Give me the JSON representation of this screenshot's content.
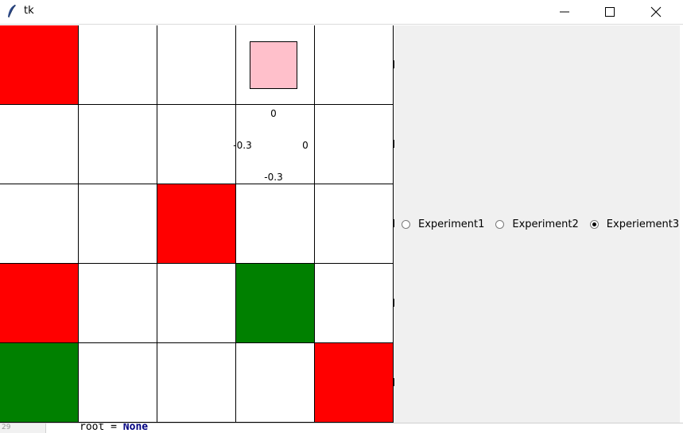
{
  "window": {
    "title": "tk",
    "icon": "tk-feather-icon",
    "controls": [
      "minimize-icon",
      "maximize-icon",
      "close-icon"
    ]
  },
  "grid": {
    "rows": 5,
    "cols": 5,
    "colors": {
      "red": "#ff0000",
      "green": "#008000",
      "white": "#ffffff",
      "agent": "#ffc0cb"
    },
    "cells": [
      [
        "red",
        "white",
        "white",
        "white",
        "white"
      ],
      [
        "white",
        "white",
        "white",
        "white",
        "white"
      ],
      [
        "white",
        "white",
        "red",
        "white",
        "white"
      ],
      [
        "red",
        "white",
        "white",
        "green",
        "white"
      ],
      [
        "green",
        "white",
        "white",
        "white",
        "red"
      ]
    ],
    "agent_cell": [
      0,
      3
    ],
    "q_values": {
      "up": "0",
      "left": "-0.3",
      "right": "0",
      "down": "-0.3"
    }
  },
  "radios": [
    {
      "label": "Experiment1",
      "checked": false
    },
    {
      "label": "Experiment2",
      "checked": false
    },
    {
      "label": "Experiement3",
      "checked": true
    }
  ],
  "editor": {
    "line_number": "29",
    "code_var": "root",
    "code_op": " = ",
    "code_kw": "None"
  }
}
